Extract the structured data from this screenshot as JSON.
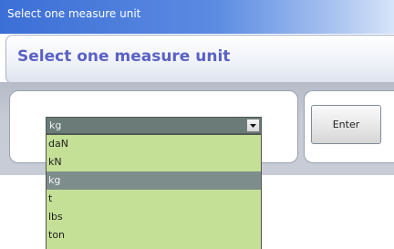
{
  "window": {
    "title": "Select one measure unit"
  },
  "header": {
    "title": "Select one measure unit"
  },
  "combo": {
    "selected": "kg",
    "options": [
      "daN",
      "kN",
      "kg",
      "t",
      "lbs",
      "ton"
    ],
    "selected_index": 2
  },
  "enter_button": {
    "label": "Enter"
  },
  "colors": {
    "header_title": "#5a62c4",
    "dropdown_bg": "#c4df96",
    "selected_bg": "#7d8d8b"
  }
}
